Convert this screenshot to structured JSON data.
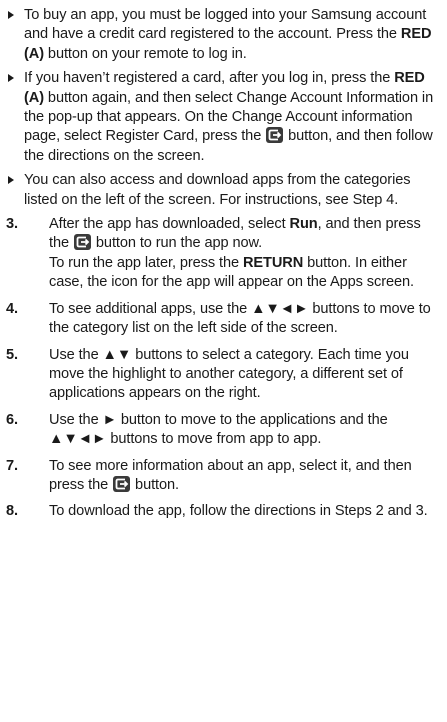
{
  "bullets": [
    {
      "p1": "To buy an app, you must be logged into your Samsung account and have a credit card registered to the account. Press the ",
      "b1": "RED (A)",
      "p2": " button on your remote to log in."
    },
    {
      "p1": "If you haven’t registered a card, after you log in, press the ",
      "b1": "RED (A)",
      "p2": " button again, and then select Change Account Information in the pop-up that appears. On the Change Account information page, select Register Card, press the ",
      "icon": "enter-button-icon",
      "p3": " button, and then follow the directions on the screen."
    },
    {
      "p1": "You can also access and download apps from the categories listed on the left of the screen. For instructions, see Step 4."
    }
  ],
  "steps": [
    {
      "num": "3.",
      "p1": "After the app has downloaded, select ",
      "b1": "Run",
      "p2": ", and then press the ",
      "icon": "enter-button-icon",
      "p3": " button to run the app now.",
      "p4": "To run the app later, press the ",
      "b2": "RETURN",
      "p5": " button. In either case, the icon for the app will appear on the Apps screen."
    },
    {
      "num": "4.",
      "p1": "To see additional apps, use the ▲▼◄► buttons to move to the category list on the left side of the screen."
    },
    {
      "num": "5.",
      "p1": "Use the ▲▼ buttons to select a category. Each time you move the highlight to another category, a different set of applications appears on the right."
    },
    {
      "num": "6.",
      "p1": "Use the ► button to move to the applications and the ▲▼◄► buttons to move from app to app."
    },
    {
      "num": "7.",
      "p1": "To see more information about an app, select it, and then press the ",
      "icon": "enter-button-icon",
      "p2": " button."
    },
    {
      "num": "8.",
      "p1": "To download the app, follow the directions in Steps 2 and 3."
    }
  ]
}
